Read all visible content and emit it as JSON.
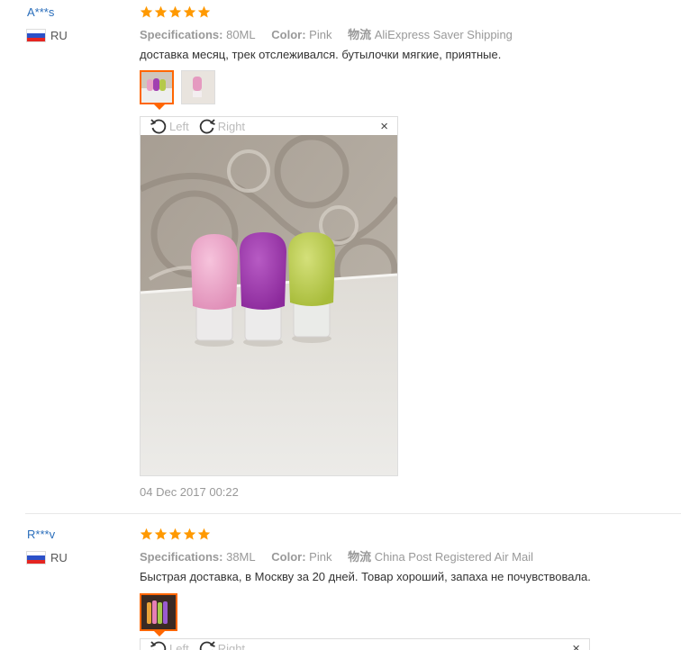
{
  "reviews": [
    {
      "user": "A***s",
      "country": "RU",
      "spec_label": "Specifications:",
      "spec_value": "80ML",
      "color_label": "Color:",
      "color_value": "Pink",
      "shipping_label": "物流",
      "shipping_value": "AliExpress Saver Shipping",
      "text": "доставка месяц, трек отслеживался. бутылочки мягкие, приятные.",
      "rotate_left": "Left",
      "rotate_right": "Right",
      "close": "×",
      "date": "04 Dec 2017 00:22"
    },
    {
      "user": "R***v",
      "country": "RU",
      "spec_label": "Specifications:",
      "spec_value": "38ML",
      "color_label": "Color:",
      "color_value": "Pink",
      "shipping_label": "物流",
      "shipping_value": "China Post Registered Air Mail",
      "text": "Быстрая доставка, в Москву за 20 дней. Товар хороший, запаха не почувствовала.",
      "rotate_left": "Left",
      "rotate_right": "Right",
      "close": "×"
    }
  ],
  "rating": {
    "stars": 5,
    "max": 5
  },
  "colors": {
    "star": "#f90",
    "link": "#2a6ebb",
    "active_thumb": "#f60"
  }
}
